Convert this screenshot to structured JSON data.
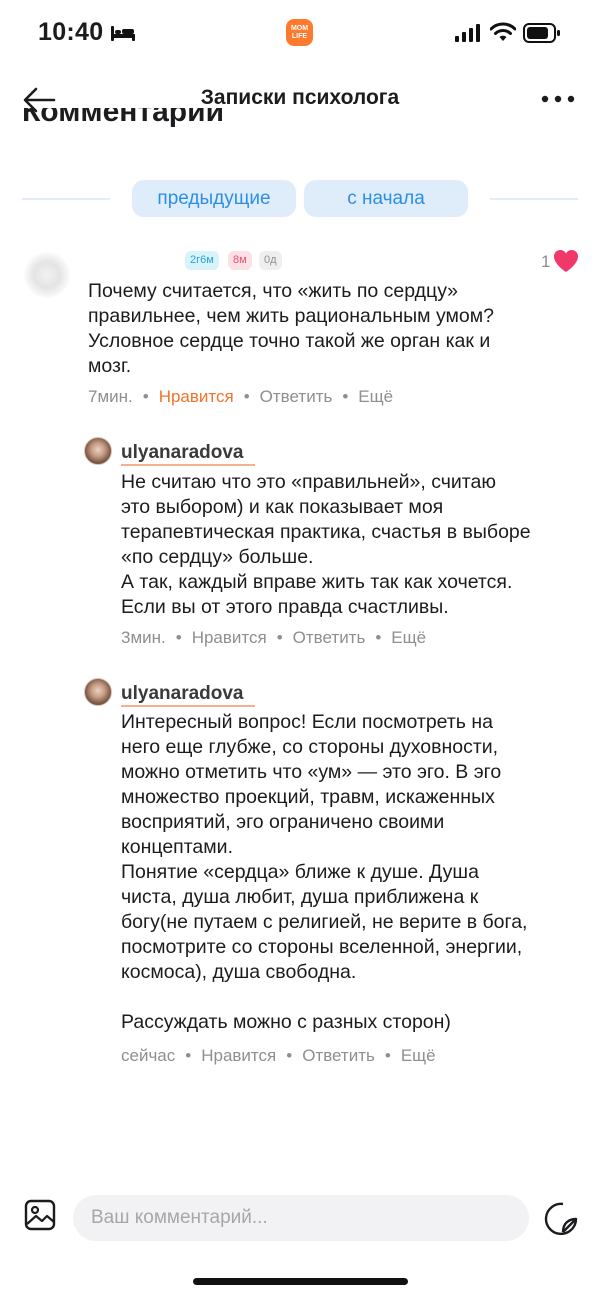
{
  "status_bar": {
    "time": "10:40",
    "app_badge_line1": "MOM",
    "app_badge_line2": "LIFE",
    "icons": [
      "bed-icon",
      "signal-icon",
      "wifi-icon",
      "battery-icon"
    ]
  },
  "nav": {
    "title": "Записки психолога",
    "back_icon": "back-arrow-icon",
    "more_icon": "more-icon"
  },
  "section_heading": "Комментарии",
  "pagination": {
    "previous_label": "предыдущие",
    "from_start_label": "с начала"
  },
  "comments": [
    {
      "badges": [
        "2г6м",
        "8м",
        "0д"
      ],
      "text": "Почему считается, что «жить по сердцу»\nправильнее, чем жить рациональным умом?\nУсловное сердце точно такой же орган как и\nмозг.",
      "time": "7мин.",
      "like_label": "Нравится",
      "reply_label": "Ответить",
      "more_label": "Ещё",
      "like_count": "1",
      "liked": true
    },
    {
      "username": "ulyanaradova",
      "text": "Не считаю что это «правильней», считаю\nэто выбором) и как показывает моя\nтерапевтическая практика, счастья в выборе\n«по сердцу» больше.\nА так, каждый вправе жить так как хочется.\nЕсли вы от этого правда счастливы.",
      "time": "3мин.",
      "like_label": "Нравится",
      "reply_label": "Ответить",
      "more_label": "Ещё"
    },
    {
      "username": "ulyanaradova",
      "text": "Интересный вопрос! Если посмотреть на\nнего еще глубже, со стороны духовности,\nможно отметить что «ум» — это эго. В эго\nмножество проекций, травм, искаженных\nвосприятий, эго ограничено своими\nконцептами.\nПонятие «сердца» ближе к душе. Душа\nчиста, душа любит, душа приближена к\nбогу(не путаем с религией, не верите в бога,\nпосмотрите со стороны вселенной, энергии,\nкосмоса), душа свободна.\n\nРассуждать можно с разных сторон)",
      "time": "сейчас",
      "like_label": "Нравится",
      "reply_label": "Ответить",
      "more_label": "Ещё"
    }
  ],
  "composer": {
    "placeholder": "Ваш комментарий...",
    "image_icon": "image-icon",
    "sticker_icon": "sticker-icon"
  },
  "colors": {
    "accent_blue": "#2e8ee6",
    "liked_orange": "#f27429",
    "heart_pink": "#f0386b",
    "pager_bg": "#dfedfa"
  }
}
